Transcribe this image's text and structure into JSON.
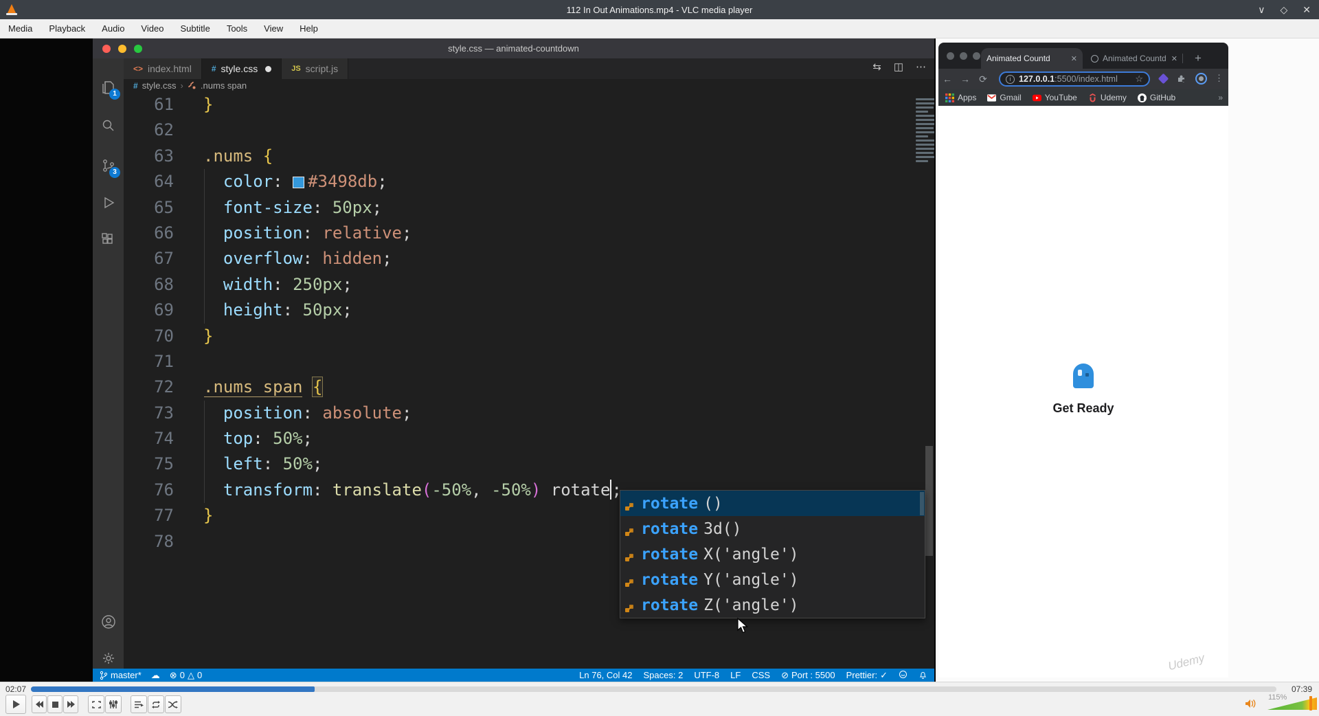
{
  "vlc": {
    "window_title": "112 In Out Animations.mp4 - VLC media player",
    "window_controls": {
      "minimize": "∨",
      "maximize": "◇",
      "close": "✕"
    },
    "menu": [
      "Media",
      "Playback",
      "Audio",
      "Video",
      "Subtitle",
      "Tools",
      "View",
      "Help"
    ],
    "time_elapsed": "02:07",
    "time_remaining": "07:39",
    "seek_fill_percent": 22.8,
    "volume_percent": "115%"
  },
  "vscode": {
    "window_title": "style.css — animated-countdown",
    "tabs": [
      {
        "label": "index.html",
        "icon": "<>"
      },
      {
        "label": "style.css",
        "icon": "#",
        "active": true,
        "modified": true
      },
      {
        "label": "script.js",
        "icon": "JS"
      }
    ],
    "editor_actions": {
      "compare": "⇆",
      "split": "◫",
      "more": "⋯"
    },
    "breadcrumb": {
      "file": "style.css",
      "separator": "›",
      "symbol": ".nums span"
    },
    "badges": {
      "explorer": "1",
      "source_control": "3"
    },
    "code": [
      {
        "n": "61",
        "indent": 0,
        "tokens": [
          [
            "brace",
            "}"
          ]
        ]
      },
      {
        "n": "62",
        "indent": 0,
        "tokens": []
      },
      {
        "n": "63",
        "indent": 0,
        "tokens": [
          [
            "sel",
            ".nums"
          ],
          [
            "plain",
            " "
          ],
          [
            "brace",
            "{"
          ]
        ]
      },
      {
        "n": "64",
        "indent": 1,
        "tokens": [
          [
            "prop",
            "  color"
          ],
          [
            "punc",
            ": "
          ],
          [
            "swatch",
            ""
          ],
          [
            "val",
            "#3498db"
          ],
          [
            "punc",
            ";"
          ]
        ]
      },
      {
        "n": "65",
        "indent": 1,
        "tokens": [
          [
            "prop",
            "  font-size"
          ],
          [
            "punc",
            ": "
          ],
          [
            "num",
            "50px"
          ],
          [
            "punc",
            ";"
          ]
        ]
      },
      {
        "n": "66",
        "indent": 1,
        "tokens": [
          [
            "prop",
            "  position"
          ],
          [
            "punc",
            ": "
          ],
          [
            "val",
            "relative"
          ],
          [
            "punc",
            ";"
          ]
        ]
      },
      {
        "n": "67",
        "indent": 1,
        "tokens": [
          [
            "prop",
            "  overflow"
          ],
          [
            "punc",
            ": "
          ],
          [
            "val",
            "hidden"
          ],
          [
            "punc",
            ";"
          ]
        ]
      },
      {
        "n": "68",
        "indent": 1,
        "tokens": [
          [
            "prop",
            "  width"
          ],
          [
            "punc",
            ": "
          ],
          [
            "num",
            "250px"
          ],
          [
            "punc",
            ";"
          ]
        ]
      },
      {
        "n": "69",
        "indent": 1,
        "tokens": [
          [
            "prop",
            "  height"
          ],
          [
            "punc",
            ": "
          ],
          [
            "num",
            "50px"
          ],
          [
            "punc",
            ";"
          ]
        ]
      },
      {
        "n": "70",
        "indent": 0,
        "tokens": [
          [
            "brace",
            "}"
          ]
        ]
      },
      {
        "n": "71",
        "indent": 0,
        "tokens": []
      },
      {
        "n": "72",
        "indent": 0,
        "tokens": [
          [
            "sel72",
            ".nums span"
          ],
          [
            "plain",
            " "
          ],
          [
            "brace72",
            "{"
          ]
        ]
      },
      {
        "n": "73",
        "indent": 1,
        "tokens": [
          [
            "prop",
            "  position"
          ],
          [
            "punc",
            ": "
          ],
          [
            "val",
            "absolute"
          ],
          [
            "punc",
            ";"
          ]
        ]
      },
      {
        "n": "74",
        "indent": 1,
        "tokens": [
          [
            "prop",
            "  top"
          ],
          [
            "punc",
            ": "
          ],
          [
            "num",
            "50%"
          ],
          [
            "punc",
            ";"
          ]
        ]
      },
      {
        "n": "75",
        "indent": 1,
        "tokens": [
          [
            "prop",
            "  left"
          ],
          [
            "punc",
            ": "
          ],
          [
            "num",
            "50%"
          ],
          [
            "punc",
            ";"
          ]
        ]
      },
      {
        "n": "76",
        "indent": 1,
        "tokens": [
          [
            "prop",
            "  transform"
          ],
          [
            "punc",
            ": "
          ],
          [
            "fn",
            "translate"
          ],
          [
            "p2",
            "("
          ],
          [
            "num",
            "-50%"
          ],
          [
            "punc",
            ", "
          ],
          [
            "num",
            "-50%"
          ],
          [
            "p2",
            ")"
          ],
          [
            "plain",
            " rotate"
          ],
          [
            "caret",
            ""
          ],
          [
            "punc",
            ";"
          ]
        ]
      },
      {
        "n": "77",
        "indent": 0,
        "tokens": [
          [
            "brace",
            "}"
          ]
        ]
      },
      {
        "n": "78",
        "indent": 0,
        "tokens": []
      }
    ],
    "autocomplete": {
      "selected_index": 0,
      "items": [
        {
          "match": "rotate",
          "rest": "()"
        },
        {
          "match": "rotate",
          "rest": "3d()"
        },
        {
          "match": "rotate",
          "rest": "X('angle')"
        },
        {
          "match": "rotate",
          "rest": "Y('angle')"
        },
        {
          "match": "rotate",
          "rest": "Z('angle')"
        }
      ]
    },
    "status_bar": {
      "branch": "master*",
      "sync": "☁",
      "errors_icon": "⊗",
      "errors": "0",
      "warnings_icon": "△",
      "warnings": "0",
      "line_col": "Ln 76, Col 42",
      "spaces": "Spaces: 2",
      "encoding": "UTF-8",
      "eol": "LF",
      "language": "CSS",
      "port_icon": "⊘",
      "port": "Port : 5500",
      "prettier": "Prettier:",
      "prettier_check": "✓"
    }
  },
  "chrome": {
    "tabs": [
      {
        "label": "Animated Countd",
        "close": "✕"
      },
      {
        "label": "Animated Countd",
        "close": "✕"
      }
    ],
    "new_tab": "+",
    "nav": {
      "back": "←",
      "forward": "→",
      "reload": "⟳"
    },
    "omnibox": {
      "info": "i",
      "url_host": "127.0.0.1",
      "url_rest": ":5500/index.html",
      "star": "☆"
    },
    "menu_dots": "⋮",
    "bookmarks": [
      {
        "label": "Apps",
        "icon": "apps"
      },
      {
        "label": "Gmail",
        "icon": "gmail"
      },
      {
        "label": "YouTube",
        "icon": "youtube"
      },
      {
        "label": "Udemy",
        "icon": "udemy"
      },
      {
        "label": "GitHub",
        "icon": "github"
      }
    ],
    "bookmarks_overflow": "»",
    "page": {
      "heading": "Get Ready"
    }
  },
  "watermark": "Udemy"
}
